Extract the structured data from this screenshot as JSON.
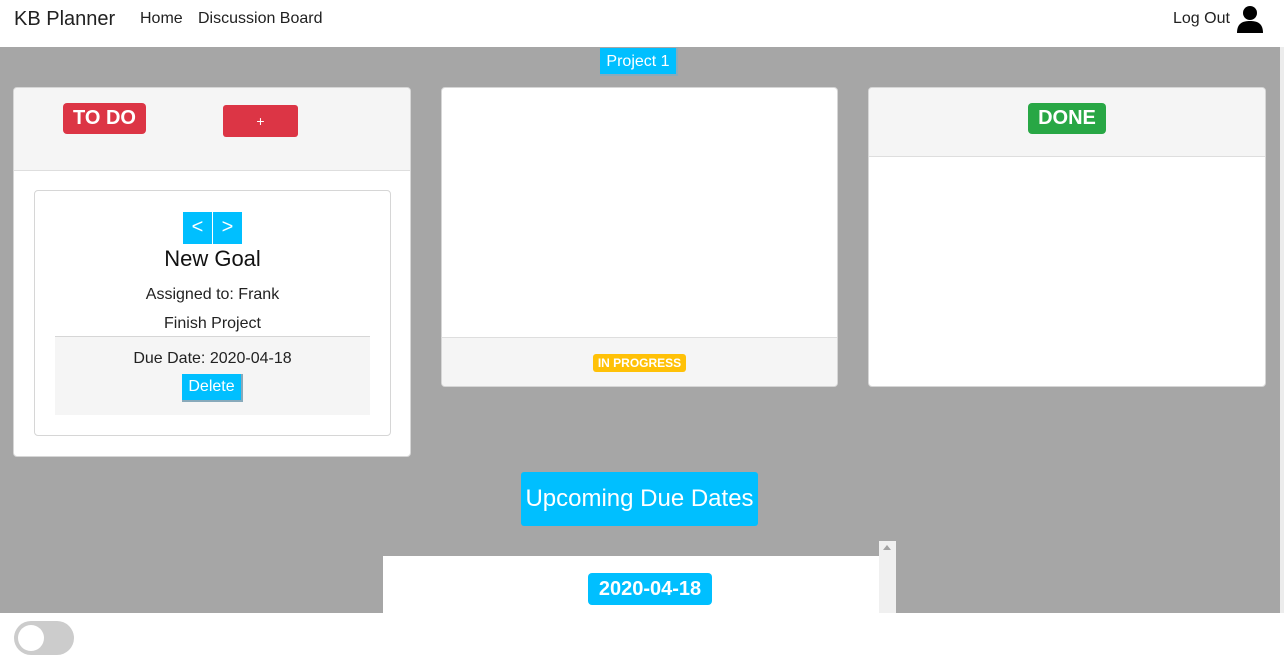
{
  "navbar": {
    "brand": "KB Planner",
    "links": [
      "Home",
      "Discussion Board"
    ],
    "logout": "Log Out",
    "user_icon": "user-icon"
  },
  "project_tab": "Project 1",
  "columns": {
    "todo": {
      "label": "TO DO",
      "add_label": "+",
      "card": {
        "prev": "<",
        "next": ">",
        "title": "New Goal",
        "assigned": "Assigned to: Frank",
        "description": "Finish Project",
        "due": "Due Date: 2020-04-18",
        "delete_label": "Delete"
      }
    },
    "in_progress": {
      "label": "IN PROGRESS"
    },
    "done": {
      "label": "DONE"
    }
  },
  "upcoming": {
    "button_label": "Upcoming Due Dates",
    "dates": [
      "2020-04-18"
    ]
  },
  "colors": {
    "accent": "#00bfff",
    "todo": "#dc3545",
    "done": "#28a745",
    "in_progress": "#ffc107",
    "background": "#a6a6a6"
  },
  "theme_toggle": {
    "on": false
  }
}
